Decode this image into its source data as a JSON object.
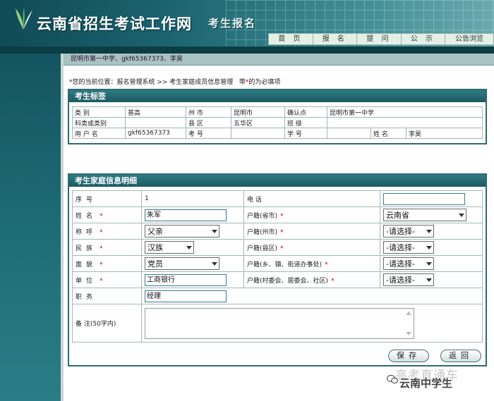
{
  "header": {
    "site_title": "云南省招生考试工作网",
    "subtitle": "考生报名",
    "nav": [
      "首 页",
      "报 名",
      "提 问",
      "公 示",
      "公告浏览"
    ]
  },
  "userbar": {
    "text": "昆明市第一中学、gkf65367373、李昊"
  },
  "location": {
    "prefix": "*您的当前位置：报名管理系统 >> 考生家庭成员信息管理",
    "hint_pre": "带",
    "hint_star": "*",
    "hint_post": "的为必填项"
  },
  "tag_panel": {
    "title": "考生标签",
    "row1": {
      "l1": "类  别",
      "v1": "普高",
      "l2": "州  市",
      "v2": "昆明市",
      "l3": "确认点",
      "v3": "昆明市第一中学"
    },
    "row2": {
      "l1": "科类或类别",
      "v1": "",
      "l2": "县  区",
      "v2": "五华区",
      "l3": "班  级",
      "v3": ""
    },
    "row3": {
      "l1": "用 户 名",
      "v1": "gkf65367373",
      "l2": "考  号",
      "v2": "",
      "l3": "学  号",
      "v3": "",
      "l4": "姓  名",
      "v4": "李昊"
    }
  },
  "family_panel": {
    "title": "考生家庭信息明细",
    "labels": {
      "seq": "序号",
      "phone": "电  话",
      "name": "姓名",
      "hukou_province": "户籍(省市)",
      "relation": "称呼",
      "hukou_city": "户籍(州市)",
      "ethnicity": "民族",
      "hukou_county": "户籍(县区)",
      "politics": "面貌",
      "hukou_town": "户籍(乡、镇、街道办事处)",
      "employer": "单位",
      "hukou_village": "户籍(村委会、居委会、社区)",
      "position": "职务",
      "remark": "备  注(50字内)"
    },
    "required_mark": "*",
    "values": {
      "seq": "1",
      "phone": "",
      "name": "朱军",
      "hukou_province": "云南省",
      "relation": "父亲",
      "hukou_city": "-请选择-",
      "ethnicity": "汉族",
      "hukou_county": "-请选择-",
      "politics": "党员",
      "hukou_town": "-请选择-",
      "employer": "工商银行",
      "hukou_village": "-请选择-",
      "position": "经理",
      "remark": ""
    },
    "buttons": {
      "save": "保存",
      "back": "返回"
    }
  },
  "watermark": {
    "faded": "高考直通车",
    "account": "云南中学生"
  },
  "colors": {
    "header_teal": "#1c6470",
    "panel_title": "#2f7a82",
    "required": "#cc0000"
  }
}
